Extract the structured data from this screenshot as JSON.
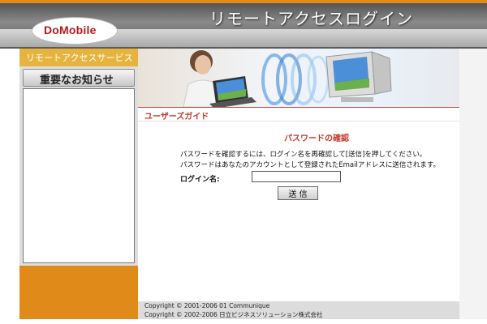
{
  "header": {
    "title": "リモートアクセスログイン",
    "logo_text": "DoMobile",
    "accent_color": "#e08a1a"
  },
  "sidebar": {
    "service_label": "リモートアクセスサービス",
    "notice_button_label": "重要なお知らせ"
  },
  "main": {
    "guide_label": "ユーザーズガイド",
    "section_title": "パスワードの確認",
    "instruction_1": "パスワードを確認するには、ログイン名を再確認して[送信]を押してください。",
    "instruction_2": "パスワードはあなたのアカウントとして登録されたEmailアドレスに送信されます。",
    "login_label": "ログイン名:",
    "login_value": "",
    "send_button_label": "送 信"
  },
  "footer": {
    "copyright_1": "Copyright © 2001-2006 01 Communique",
    "copyright_2": "Copyright © 2002-2006 日立ビジネスソリューション株式会社"
  },
  "colors": {
    "orange": "#e08a1a",
    "gold": "#e6b43e",
    "red_text": "#c0392b"
  }
}
